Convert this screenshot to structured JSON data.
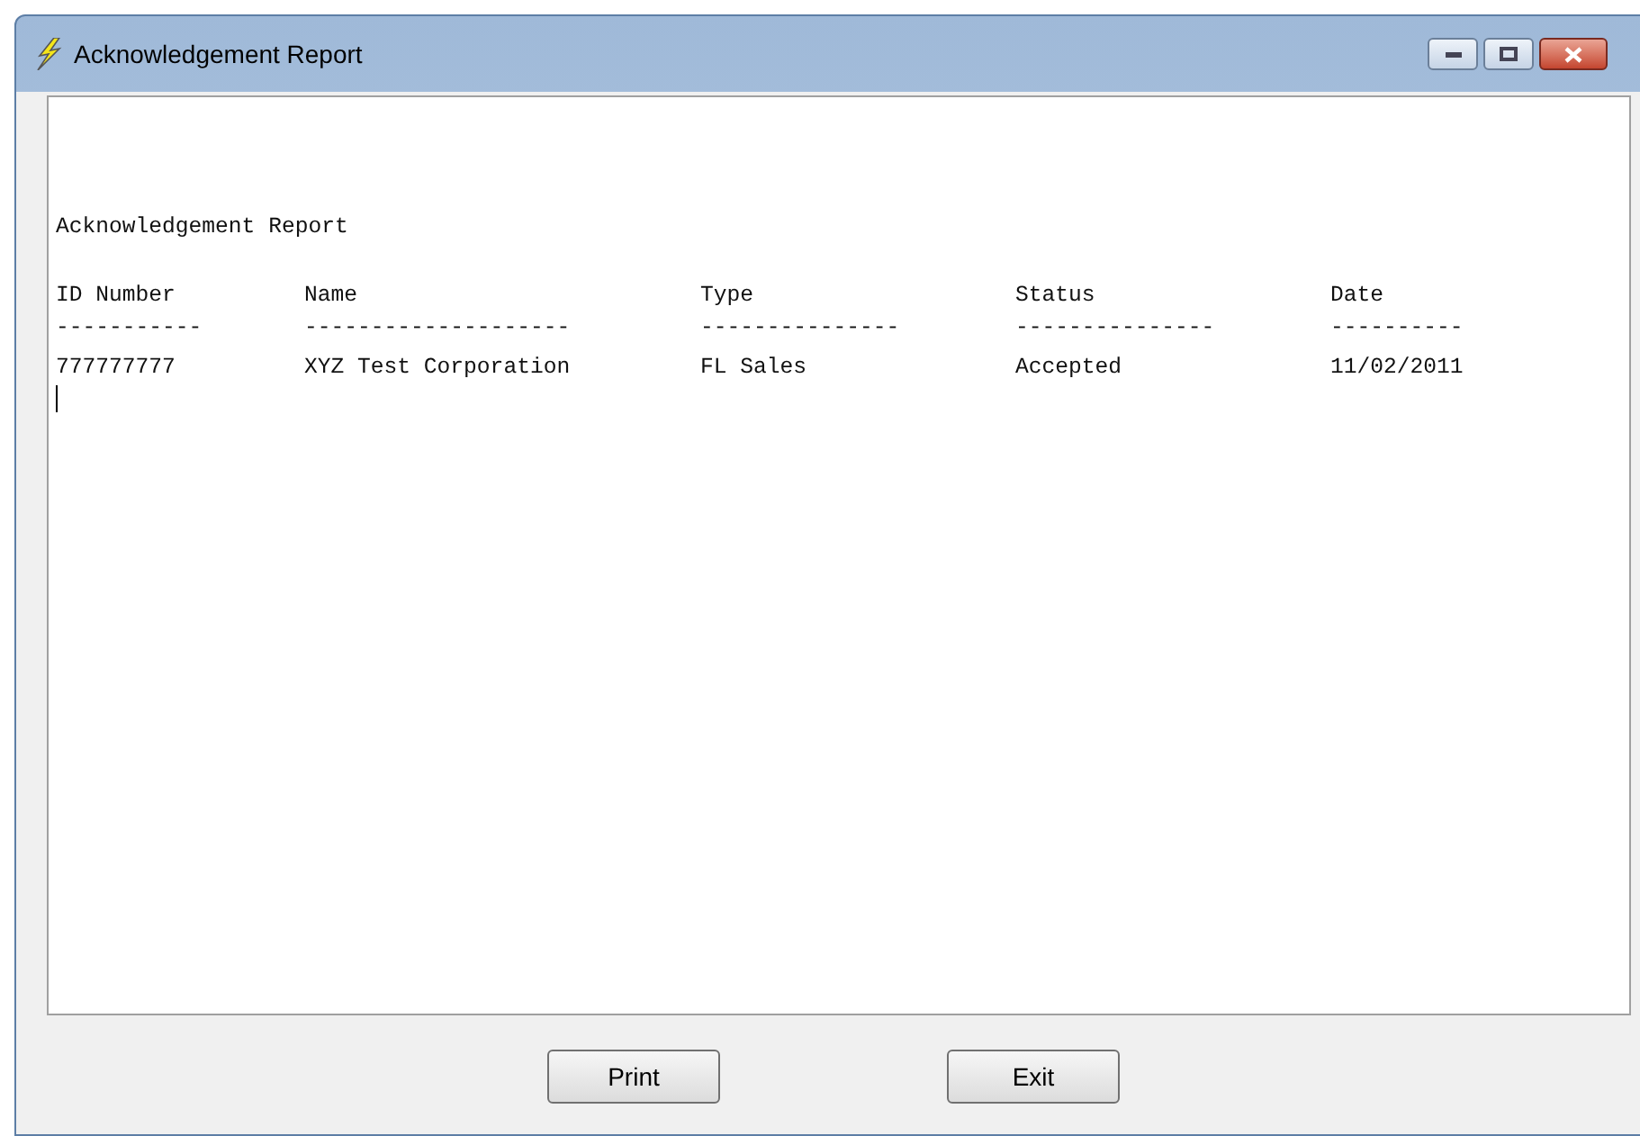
{
  "window": {
    "title": "Acknowledgement Report"
  },
  "report": {
    "heading": "Acknowledgement Report",
    "columns": [
      {
        "label": "ID Number",
        "rule": "-----------"
      },
      {
        "label": "Name",
        "rule": "--------------------"
      },
      {
        "label": "Type",
        "rule": "---------------"
      },
      {
        "label": "Status",
        "rule": "---------------"
      },
      {
        "label": "Date",
        "rule": "----------"
      }
    ],
    "rows": [
      [
        "777777777",
        "XYZ Test Corporation",
        "FL Sales",
        "Accepted",
        "11/02/2011"
      ]
    ]
  },
  "buttons": [
    "Print",
    "Exit"
  ]
}
